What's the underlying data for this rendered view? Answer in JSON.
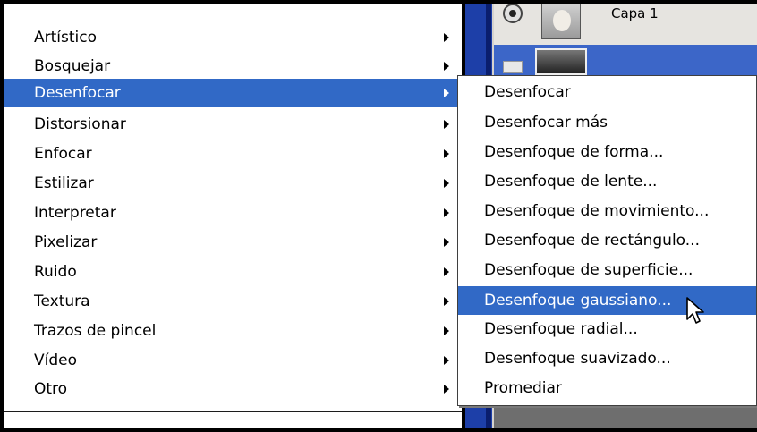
{
  "layers_panel": {
    "layer_name": "Capa 1"
  },
  "filter_menu": {
    "items": [
      {
        "label": "Artístico",
        "has_submenu": true
      },
      {
        "label": "Bosquejar",
        "has_submenu": true
      },
      {
        "label": "Desenfocar",
        "has_submenu": true,
        "highlighted": true
      },
      {
        "label": "Distorsionar",
        "has_submenu": true
      },
      {
        "label": "Enfocar",
        "has_submenu": true
      },
      {
        "label": "Estilizar",
        "has_submenu": true
      },
      {
        "label": "Interpretar",
        "has_submenu": true
      },
      {
        "label": "Pixelizar",
        "has_submenu": true
      },
      {
        "label": "Ruido",
        "has_submenu": true
      },
      {
        "label": "Textura",
        "has_submenu": true
      },
      {
        "label": "Trazos de pincel",
        "has_submenu": true
      },
      {
        "label": "Vídeo",
        "has_submenu": true
      },
      {
        "label": "Otro",
        "has_submenu": true
      }
    ]
  },
  "blur_submenu": {
    "items": [
      {
        "label": "Desenfocar"
      },
      {
        "label": "Desenfocar más"
      },
      {
        "label": "Desenfoque de forma..."
      },
      {
        "label": "Desenfoque de lente..."
      },
      {
        "label": "Desenfoque de movimiento..."
      },
      {
        "label": "Desenfoque de rectángulo..."
      },
      {
        "label": "Desenfoque de superficie..."
      },
      {
        "label": "Desenfoque gaussiano...",
        "highlighted": true
      },
      {
        "label": "Desenfoque radial..."
      },
      {
        "label": "Desenfoque suavizado..."
      },
      {
        "label": "Promediar"
      }
    ]
  },
  "colors": {
    "highlight": "#3169c6",
    "menu_background": "#ffffff",
    "panel_accent": "#1d3fa8"
  },
  "icons": {
    "submenu_arrow": "triangle-right-icon",
    "cursor": "mouse-pointer-icon",
    "visibility": "eye-icon"
  }
}
